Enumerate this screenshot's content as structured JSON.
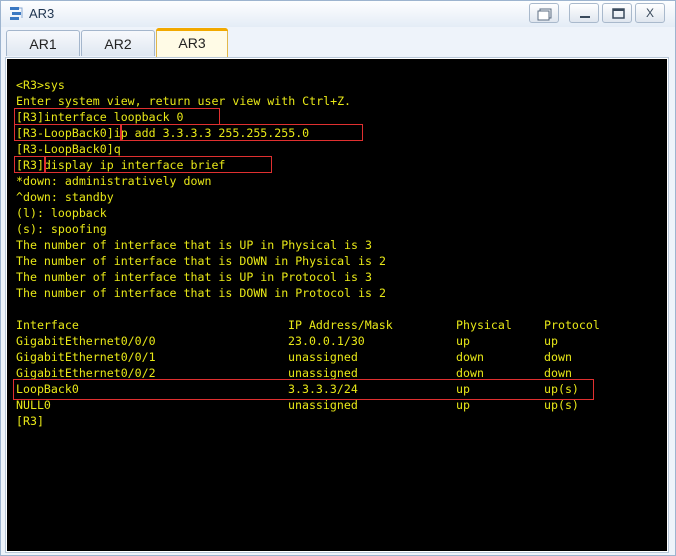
{
  "window": {
    "title": "AR3",
    "controls": [
      "restore",
      "minimize",
      "maximize",
      "close"
    ],
    "close_glyph": "X"
  },
  "tabs": [
    {
      "label": "AR1",
      "active": false
    },
    {
      "label": "AR2",
      "active": false
    },
    {
      "label": "AR3",
      "active": true
    }
  ],
  "terminal": {
    "lines": [
      "<R3>sys",
      "Enter system view, return user view with Ctrl+Z.",
      "[R3]interface loopback 0",
      "[R3-LoopBack0]ip add 3.3.3.3 255.255.255.0",
      "[R3-LoopBack0]q",
      "[R3]display ip interface brief",
      "*down: administratively down",
      "^down: standby",
      "(l): loopback",
      "(s): spoofing",
      "The number of interface that is UP in Physical is 3",
      "The number of interface that is DOWN in Physical is 2",
      "The number of interface that is UP in Protocol is 3",
      "The number of interface that is DOWN in Protocol is 2"
    ],
    "table": {
      "headers": [
        "Interface",
        "IP Address/Mask",
        "Physical",
        "Protocol"
      ],
      "rows": [
        [
          "GigabitEthernet0/0/0",
          "23.0.0.1/30",
          "up",
          "up"
        ],
        [
          "GigabitEthernet0/0/1",
          "unassigned",
          "down",
          "down"
        ],
        [
          "GigabitEthernet0/0/2",
          "unassigned",
          "down",
          "down"
        ],
        [
          "LoopBack0",
          "3.3.3.3/24",
          "up",
          "up(s)"
        ],
        [
          "NULL0",
          "unassigned",
          "up",
          "up(s)"
        ]
      ]
    },
    "prompt": "[R3]",
    "text_color": "#e8e817",
    "background": "#000000",
    "highlight_color": "#e03030"
  }
}
